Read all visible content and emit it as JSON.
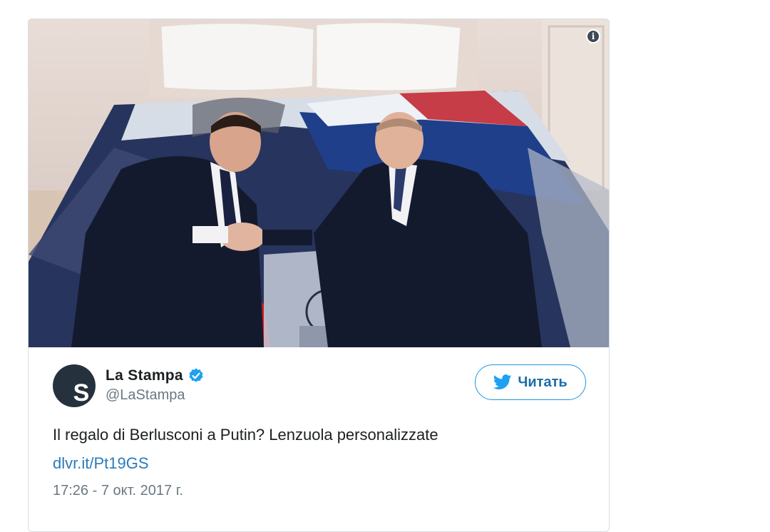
{
  "media": {
    "info_icon_glyph": "i",
    "alt_colors": {
      "sheet_blue": "#1f3f8a",
      "sheet_red": "#c3202a",
      "suit_dark": "#141a2e",
      "wall": "#d9cbc4"
    }
  },
  "author": {
    "display_name": "La Stampa",
    "handle": "@LaStampa",
    "avatar_letter": "S",
    "verified_icon": "verified-badge-icon"
  },
  "follow_button": {
    "label": "Читать",
    "icon": "twitter-bird-icon"
  },
  "tweet": {
    "text": "Il regalo di Berlusconi a Putin? Lenzuola personalizzate",
    "link": "dlvr.it/Pt19GS",
    "timestamp": "17:26 - 7 окт. 2017 г."
  },
  "colors": {
    "accent": "#1b95e0",
    "link": "#2b7bb9",
    "secondary_text": "#697882",
    "primary_text": "#1c2022"
  }
}
